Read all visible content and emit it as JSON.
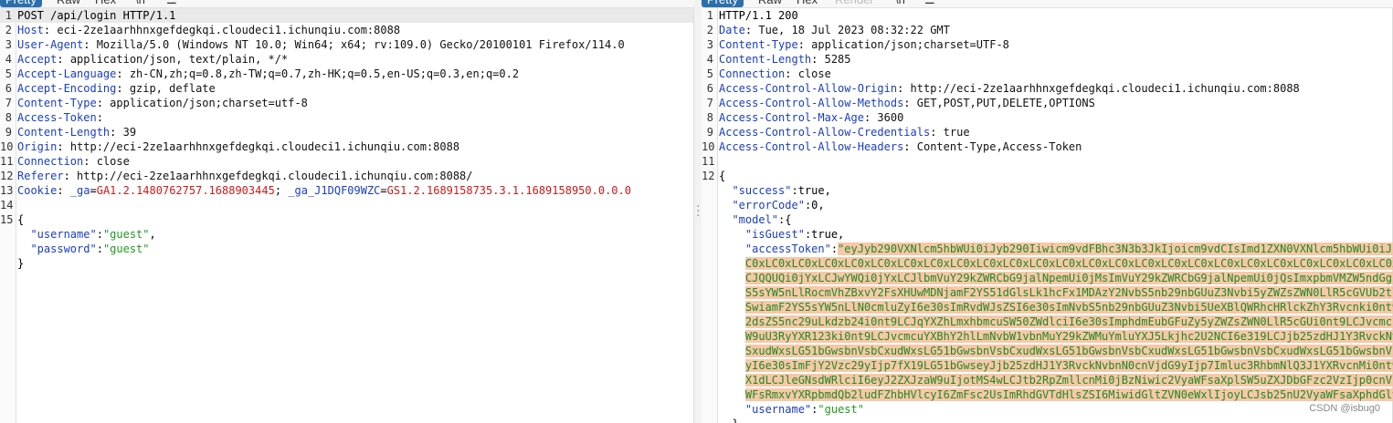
{
  "request": {
    "tabs": [
      "Pretty",
      "Raw",
      "Hex",
      "\\n",
      "☰"
    ],
    "lines": [
      {
        "n": "1",
        "text": "POST /api/login HTTP/1.1"
      },
      {
        "n": "2",
        "k": "Host",
        "v": "eci-2ze1aarhhnxgefdegkqi.cloudeci1.ichunqiu.com:8088"
      },
      {
        "n": "3",
        "k": "User-Agent",
        "v": "Mozilla/5.0 (Windows NT 10.0; Win64; x64; rv:109.0) Gecko/20100101 Firefox/114.0"
      },
      {
        "n": "4",
        "k": "Accept",
        "v": "application/json, text/plain, */*"
      },
      {
        "n": "5",
        "k": "Accept-Language",
        "v": "zh-CN,zh;q=0.8,zh-TW;q=0.7,zh-HK;q=0.5,en-US;q=0.3,en;q=0.2"
      },
      {
        "n": "6",
        "k": "Accept-Encoding",
        "v": "gzip, deflate"
      },
      {
        "n": "7",
        "k": "Content-Type",
        "v": "application/json;charset=utf-8"
      },
      {
        "n": "8",
        "k": "Access-Token",
        "v": ""
      },
      {
        "n": "9",
        "k": "Content-Length",
        "v": "39"
      },
      {
        "n": "10",
        "k": "Origin",
        "v": "http://eci-2ze1aarhhnxgefdegkqi.cloudeci1.ichunqiu.com:8088"
      },
      {
        "n": "11",
        "k": "Connection",
        "v": "close"
      },
      {
        "n": "12",
        "k": "Referer",
        "v": "http://eci-2ze1aarhhnxgefdegkqi.cloudeci1.ichunqiu.com:8088/"
      },
      {
        "n": "13",
        "k": "Cookie",
        "cookie": true
      },
      {
        "n": "14",
        "text": ""
      },
      {
        "n": "15",
        "text": "{"
      },
      {
        "n": "",
        "json": true,
        "jk": "\"username\"",
        "js": "\"guest\"",
        "tail": ","
      },
      {
        "n": "",
        "json": true,
        "jk": "\"password\"",
        "js": "\"guest\"",
        "tail": ""
      },
      {
        "n": "",
        "text": "}"
      }
    ],
    "cookie": {
      "k1": "_ga",
      "v1": "GA1.2.1480762757.1688903445",
      "k2": "_ga_J1DQF09WZC",
      "v2": "GS1.2.1689158735.3.1.1689158950.0.0.0"
    }
  },
  "response": {
    "tabs": [
      "Pretty",
      "Raw",
      "Hex",
      "Render",
      "\\n",
      "☰"
    ],
    "lines": [
      {
        "n": "1",
        "text": "HTTP/1.1 200"
      },
      {
        "n": "2",
        "k": "Date",
        "v": "Tue, 18 Jul 2023 08:32:22 GMT"
      },
      {
        "n": "3",
        "k": "Content-Type",
        "v": "application/json;charset=UTF-8"
      },
      {
        "n": "4",
        "k": "Content-Length",
        "v": "5285"
      },
      {
        "n": "5",
        "k": "Connection",
        "v": "close"
      },
      {
        "n": "6",
        "k": "Access-Control-Allow-Origin",
        "v": "http://eci-2ze1aarhhnxgefdegkqi.cloudeci1.ichunqiu.com:8088"
      },
      {
        "n": "7",
        "k": "Access-Control-Allow-Methods",
        "v": "GET,POST,PUT,DELETE,OPTIONS"
      },
      {
        "n": "8",
        "k": "Access-Control-Max-Age",
        "v": "3600"
      },
      {
        "n": "9",
        "k": "Access-Control-Allow-Credentials",
        "v": "true"
      },
      {
        "n": "10",
        "k": "Access-Control-Allow-Headers",
        "v": "Content-Type,Access-Token"
      },
      {
        "n": "11",
        "text": ""
      },
      {
        "n": "12",
        "text": "{"
      },
      {
        "n": "",
        "ind": 1,
        "jk": "\"success\"",
        "raw": ":true,"
      },
      {
        "n": "",
        "ind": 1,
        "jk": "\"errorCode\"",
        "raw": ":0,"
      },
      {
        "n": "",
        "ind": 1,
        "jk": "\"model\"",
        "raw": ":{"
      },
      {
        "n": "",
        "ind": 2,
        "jk": "\"isGuest\"",
        "raw": ":true,"
      },
      {
        "n": "",
        "ind": 2,
        "jk": "\"accessToken\"",
        "raw": ":",
        "sel": "\"eyJyb290VXNlcm5hbWUi0iJyb290Iiwicm9vdFBhc3N3b3JkIjoicm9vdCIsImd1ZXN0VXNlcm5hbWUi0iJndW"
      },
      {
        "n": "",
        "ind": 2,
        "selonly": "C0xLC0xLC0xLC0xLC0xLC0xLC0xLC0xLC0xLC0xLC0xLC0xLC0xLC0xLC0xLC0xLC0xLC0xLC0xLC0xLC0xLC0xLC0xLC0xLC0xLC"
      },
      {
        "n": "",
        "ind": 2,
        "selonly": "CJQQUQi0jYxLCJwYWQi0jYxLCJlbmVuY29kZWRCbG9jalNpemUi0jMsImVuY29kZWRCbG9jalNpemUi0jQsImxpbmVMZW5ndGgi0jQ"
      },
      {
        "n": "",
        "ind": 2,
        "selonly": "S5sYW5nLlRocmVhZBxvY2FsXHUwMDNjamF2YS51dGlsLk1hcFx1MDAzY2NvbS5nb29nbGUuZ3Nvbi5yZWZsZWN0LlR5cGVUb2tlbiJ"
      },
      {
        "n": "",
        "ind": 2,
        "selonly": "SwiamF2YS5sYW5nLlN0cmluZyI6e30sImRvdWJsZSI6e30sImNvbS5nb29nbGUuZ3Nvbi5UeXBlQWRhcHRlckZhY3Rvcnki0nt9LC"
      },
      {
        "n": "",
        "ind": 2,
        "selonly": "2dsZS5nc29uLkdzb24i0nt9LCJqYXZhLmxhbmcuSW50ZWdlciI6e30sImphdmEubGFuZy5yZWZsZWN0LlR5cGUi0nt9LCJvcmcuYXB"
      },
      {
        "n": "",
        "ind": 2,
        "selonly": "W9uU3RyYXR123ki0nt9LCJvcmcuYXBhY2hlLmNvbW1vbnMuY29kZWMuYmluYXJ5Lkjhc2U2NCI6e319LCJjb25zdHJ1Y3RvckNvbnN"
      },
      {
        "n": "",
        "ind": 2,
        "selonly": "SxudWxsLG51bGwsbnVsbCxudWxsLG51bGwsbnVsbCxudWxsLG51bGwsbnVsbCxudWxsLG51bGwsbnVsbCxudWxsLG51bGwsbnVsbG"
      },
      {
        "n": "",
        "ind": 2,
        "selonly": "yI6e30sImFjY2Vzc29yIjp7fX19LG51bGwseyJjb25zdHJ1Y3RvckNvbnN0cnVjdG9yIjp7Imluc3RhbmNlQ3J1YXRvcnMi0nt9LC"
      },
      {
        "n": "",
        "ind": 2,
        "selonly": "X1dLCJleGNsdWRlciI6eyJ2ZXJzaW9uIjotMS4wLCJtb2RpZmllcnMi0jBzNiwic2VyaWFsaXplSW5uZXJDbGFzc2VzIjp0cnVlLC"
      },
      {
        "n": "",
        "ind": 2,
        "selonly": "WFsRmxvYXRpbmdQb2ludFZhbHVlcyI6ZmFsc2UsImRhdGVTdHlsZSI6MiwidGltZVN0eWxlIjoyLCJsb25nU2VyaWFsaXphdGlvb"
      },
      {
        "n": "",
        "ind": 2,
        "jk": "\"username\"",
        "raw": ":",
        "js": "\"guest\""
      },
      {
        "n": "",
        "ind": 1,
        "text": "}"
      }
    ]
  },
  "watermark": "CSDN @isbug0"
}
